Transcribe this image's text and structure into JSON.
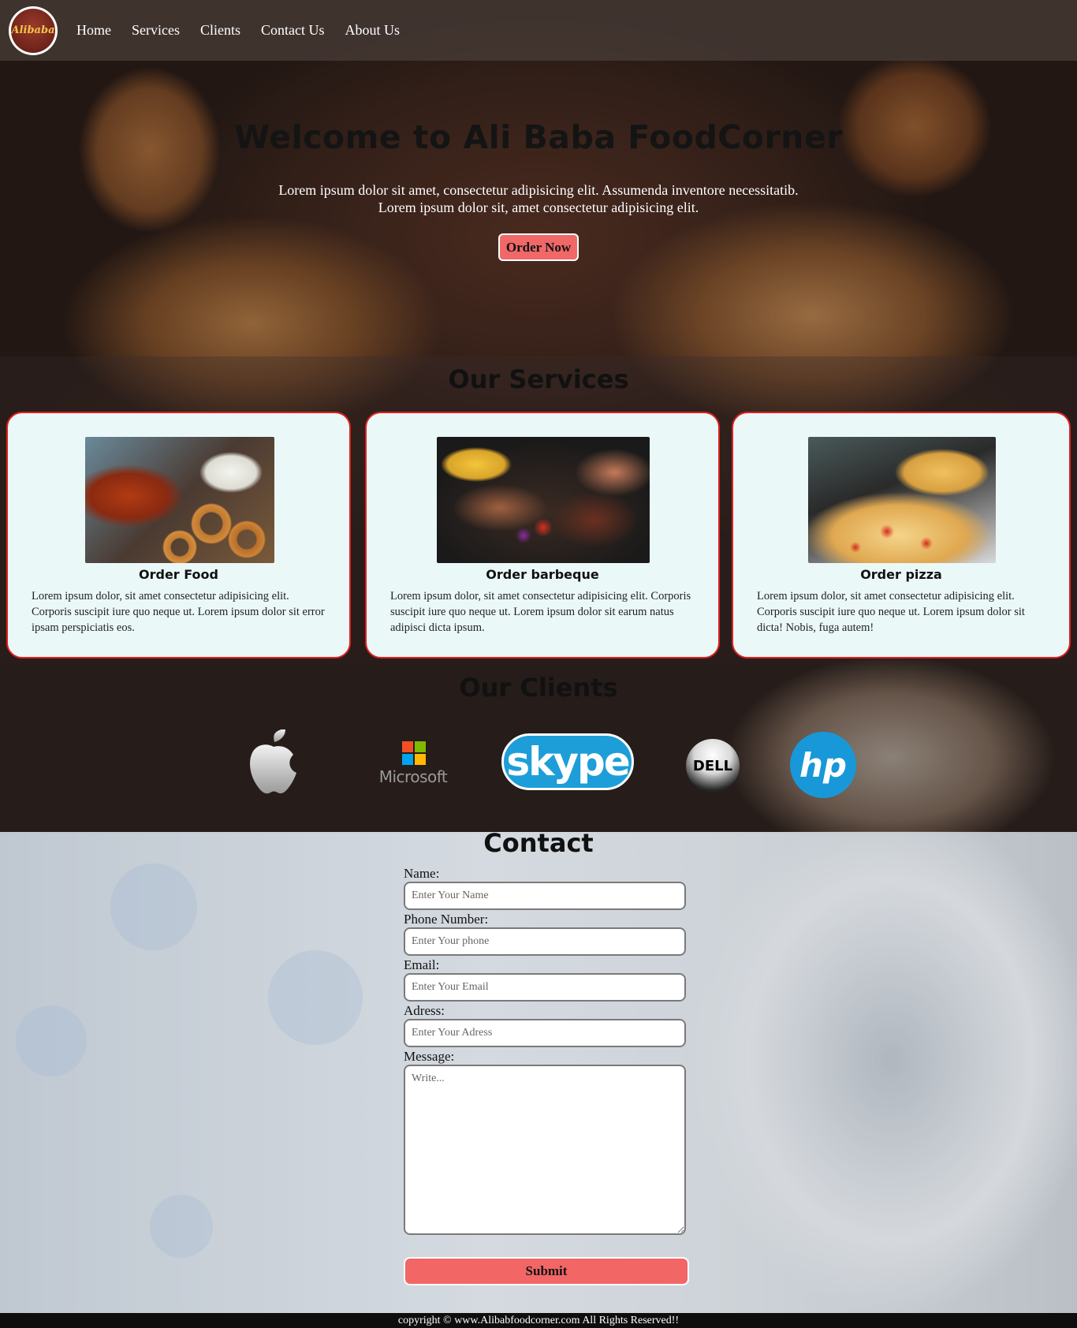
{
  "header": {
    "logo_text": "Alibaba",
    "nav": [
      {
        "label": "Home"
      },
      {
        "label": "Services"
      },
      {
        "label": "Clients"
      },
      {
        "label": "Contact Us"
      },
      {
        "label": "About Us"
      }
    ]
  },
  "hero": {
    "title": "Welcome to Ali Baba FoodCorner",
    "text_line1": "Lorem ipsum dolor sit amet, consectetur adipisicing elit. Assumenda inventore necessitatib.",
    "text_line2": "Lorem ipsum dolor sit, amet consectetur adipisicing elit.",
    "button_label": "Order Now"
  },
  "services": {
    "title": "Our Services",
    "cards": [
      {
        "title": "Order Food",
        "text": "Lorem ipsum dolor, sit amet consectetur adipisicing elit. Corporis suscipit iure quo neque ut. Lorem ipsum dolor sit error ipsam perspiciatis eos.",
        "image": "wings-onion-rings-photo"
      },
      {
        "title": "Order barbeque",
        "text": "Lorem ipsum dolor, sit amet consectetur adipisicing elit. Corporis suscipit iure quo neque ut. Lorem ipsum dolor sit earum natus adipisci dicta ipsum.",
        "image": "barbeque-grill-photo"
      },
      {
        "title": "Order pizza",
        "text": "Lorem ipsum dolor, sit amet consectetur adipisicing elit. Corporis suscipit iure quo neque ut. Lorem ipsum dolor sit dicta! Nobis, fuga autem!",
        "image": "pizza-photo"
      }
    ]
  },
  "clients": {
    "title": "Our Clients",
    "logos": {
      "apple": "apple-icon",
      "microsoft": "Microsoft",
      "skype": "skype",
      "dell": "DELL",
      "hp": "hp"
    }
  },
  "contact": {
    "title": "Contact",
    "fields": {
      "name_label": "Name:",
      "name_placeholder": "Enter Your Name",
      "phone_label": "Phone Number:",
      "phone_placeholder": "Enter Your phone",
      "email_label": "Email:",
      "email_placeholder": "Enter Your Email",
      "address_label": "Adress:",
      "address_placeholder": "Enter Your Adress",
      "message_label": "Message:",
      "message_placeholder": "Write..."
    },
    "submit_label": "Submit"
  },
  "footer": {
    "text": "copyright © www.Alibabfoodcorner.com All Rights Reserved!!"
  },
  "colors": {
    "accent_button": "#f26666",
    "card_border": "#e02020",
    "card_bg": "#eaf8f8"
  }
}
